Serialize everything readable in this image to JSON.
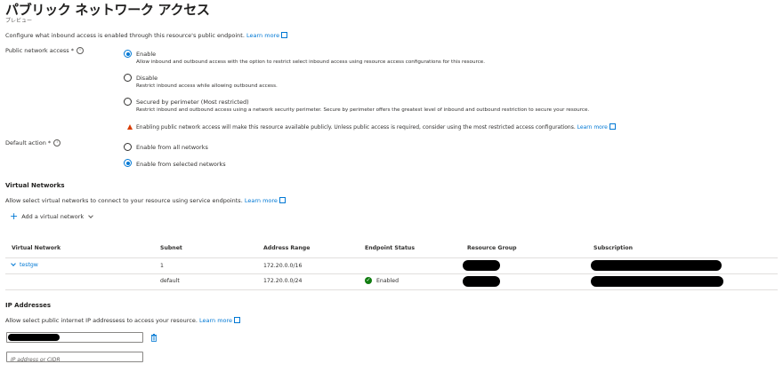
{
  "header": {
    "title": "パブリック ネットワーク アクセス",
    "more": "···",
    "subtitle": "プレビュー"
  },
  "intro": {
    "text": "Configure what inbound access is enabled through this resource's public endpoint.",
    "link": "Learn more"
  },
  "public_access": {
    "label": "Public network access *",
    "options": [
      {
        "label": "Enable",
        "desc": "Allow inbound and outbound access with the option to restrict select inbound access using resource access configurations for this resource.",
        "selected": true
      },
      {
        "label": "Disable",
        "desc": "Restrict inbound access while allowing outbound access.",
        "selected": false
      },
      {
        "label": "Secured by perimeter (Most restricted)",
        "desc": "Restrict inbound and outbound access using a network security perimeter. Secure by perimeter offers the greatest level of inbound and outbound restriction to secure your resource.",
        "selected": false
      }
    ],
    "warning": "Enabling public network access will make this resource available publicly. Unless public access is required, consider using the most restricted access configurations.",
    "warning_link": "Learn more"
  },
  "default_action": {
    "label": "Default action *",
    "options": [
      {
        "label": "Enable from all networks",
        "selected": false
      },
      {
        "label": "Enable from selected networks",
        "selected": true
      }
    ]
  },
  "virtual_networks": {
    "title": "Virtual Networks",
    "desc": "Allow select virtual networks to connect to your resource using service endpoints.",
    "link": "Learn more",
    "add_label": "Add a virtual network",
    "columns": [
      "Virtual Network",
      "Subnet",
      "Address Range",
      "Endpoint Status",
      "Resource Group",
      "Subscription"
    ],
    "rows": [
      {
        "vnet": "testgw",
        "subnet": "1",
        "range": "172.20.0.0/16",
        "status": ""
      },
      {
        "vnet": "",
        "subnet": "default",
        "range": "172.20.0.0/24",
        "status": "Enabled"
      }
    ]
  },
  "ip_addresses": {
    "title": "IP Addresses",
    "desc": "Allow select public internet IP addressess to access your resource.",
    "link": "Learn more",
    "placeholder": "IP address or CIDR"
  },
  "colors": {
    "accent": "#0078d4",
    "warning": "#d83b01",
    "success": "#107c10"
  }
}
